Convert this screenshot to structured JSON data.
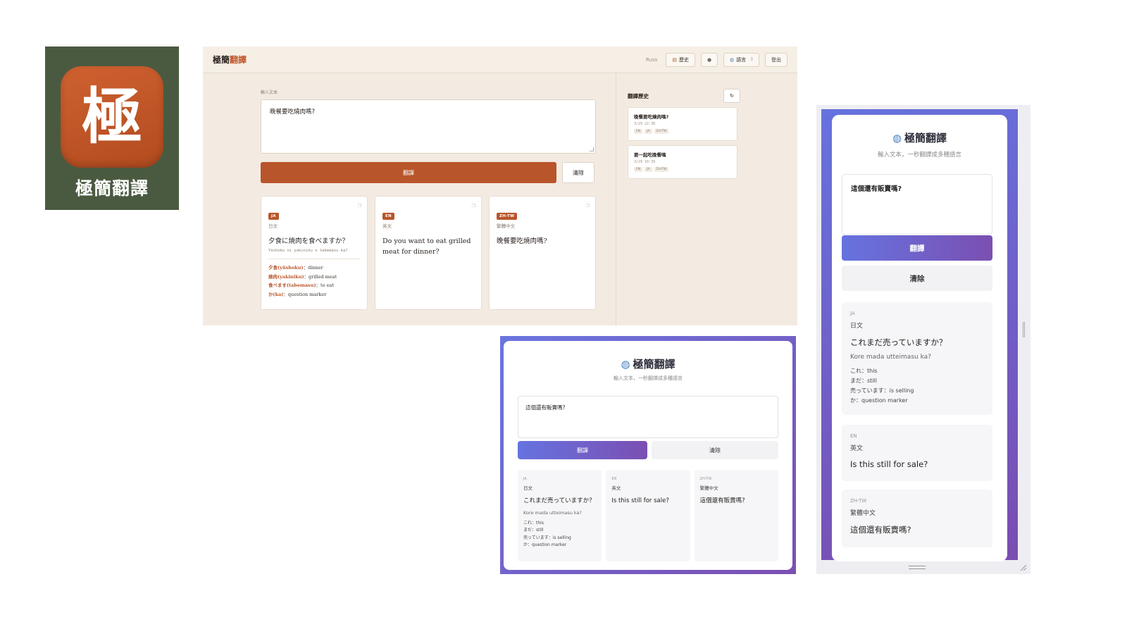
{
  "app_icon": {
    "glyph": "極",
    "name": "極簡翻譯"
  },
  "desktop": {
    "brand_main": "極簡",
    "brand_accent": "翻譯",
    "user": "Russ",
    "nav": {
      "history": "歷史",
      "languages": "語言",
      "language_count": "3",
      "logout": "登出"
    },
    "input_label": "輸入文本",
    "input_value": "晚餐要吃燒肉嗎?",
    "translate_label": "翻譯",
    "clear_label": "清除",
    "results": [
      {
        "badge": "JA",
        "lang": "日文",
        "text": "夕食に焼肉を食べますか？",
        "romaji": "Yūshoku ni yakiniku o tabemasu ka?",
        "gloss": [
          {
            "term": "夕食(yūshoku)",
            "meaning": "：dinner"
          },
          {
            "term": "焼肉(yakiniku)",
            "meaning": "：grilled meat"
          },
          {
            "term": "食べます(tabemasu)",
            "meaning": "：to eat"
          },
          {
            "term": "か(ka)",
            "meaning": "：question marker"
          }
        ]
      },
      {
        "badge": "EN",
        "lang": "英文",
        "text": "Do you want to eat grilled meat for dinner?"
      },
      {
        "badge": "ZH-TW",
        "lang": "繁體中文",
        "text": "晚餐要吃燒肉嗎?"
      }
    ],
    "history_title": "翻譯歷史",
    "refresh_glyph": "↻",
    "history": [
      {
        "text": "晚餐要吃燒肉嗎?",
        "time": "3/29 22:38",
        "tags": [
          "EN",
          "JA",
          "ZH-TW"
        ]
      },
      {
        "text": "要一起吃晚餐嗎",
        "time": "3/29 10:39",
        "tags": [
          "EN",
          "JA",
          "ZH-TW"
        ]
      }
    ]
  },
  "widget": {
    "title": "極簡翻譯",
    "subtitle": "輸入文本，一秒翻譯成多種語言",
    "input_value": "這個還有販賣嗎?",
    "translate_label": "翻譯",
    "clear_label": "清除",
    "results": [
      {
        "code": "JA",
        "lang": "日文",
        "text": "これまだ売っていますか？",
        "romaji": "Kore mada utteimasu ka?",
        "gloss": [
          "これ：this",
          "まだ：still",
          "売っています：is selling",
          "か：question marker"
        ]
      },
      {
        "code": "EN",
        "lang": "英文",
        "text": "Is this still for sale?"
      },
      {
        "code": "ZH-TW",
        "lang": "繁體中文",
        "text": "這個還有販賣嗎?"
      }
    ]
  },
  "mobile": {
    "title": "極簡翻譯",
    "subtitle": "輸入文本，一秒翻譯成多種語言",
    "input_value": "這個還有販賣嗎?",
    "translate_label": "翻譯",
    "clear_label": "清除",
    "results": [
      {
        "code": "JA",
        "lang": "日文",
        "text": "これまだ売っていますか？",
        "romaji": "Kore mada utteimasu ka?",
        "gloss": [
          "これ：this",
          "まだ：still",
          "売っています：is selling",
          "か：question marker"
        ]
      },
      {
        "code": "EN",
        "lang": "英文",
        "text": "Is this still for sale?"
      },
      {
        "code": "ZH-TW",
        "lang": "繁體中文",
        "text": "這個還有販賣嗎?"
      }
    ]
  },
  "colors": {
    "accent": "#b9552a",
    "icon_bg": "#4a5a40",
    "purple_start": "#6673e0",
    "purple_end": "#7b4fb2"
  }
}
